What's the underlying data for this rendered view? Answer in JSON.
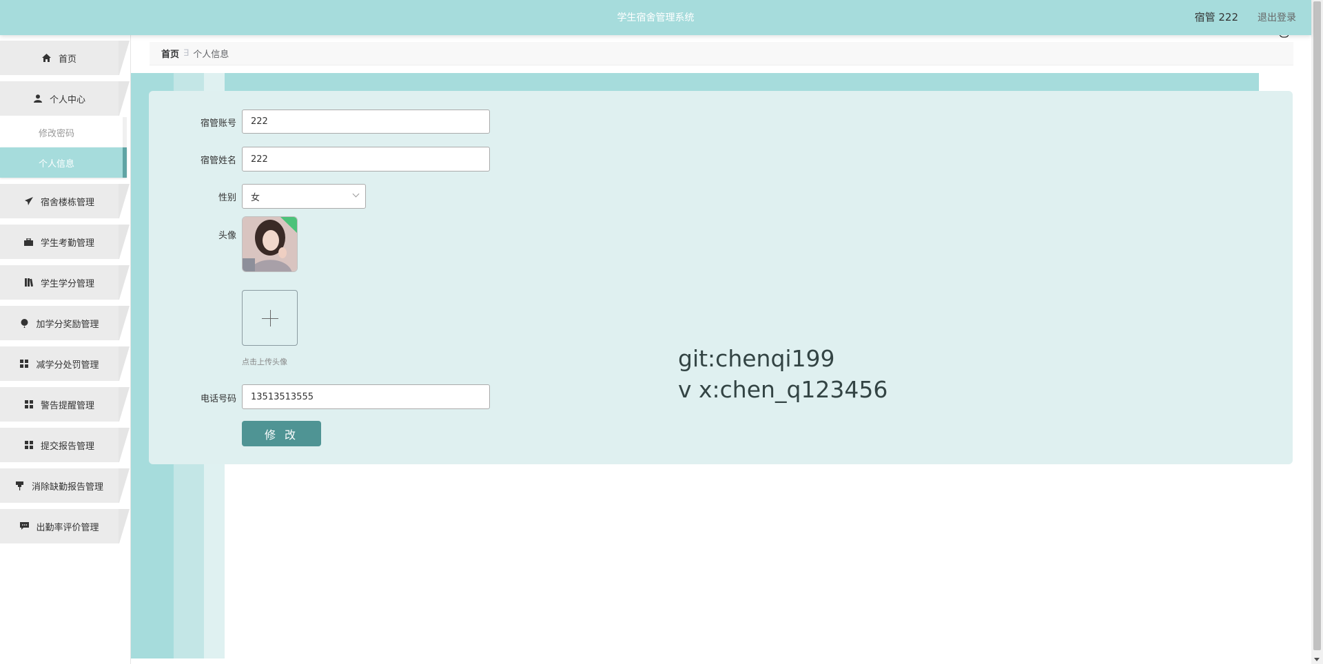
{
  "header": {
    "title": "学生宿舍管理系统",
    "user": "宿管 222",
    "logout": "退出登录"
  },
  "sidebar": {
    "items": [
      {
        "label": "首页",
        "icon": "home-icon"
      },
      {
        "label": "个人中心",
        "icon": "user-icon"
      },
      {
        "label": "宿舍楼栋管理",
        "icon": "paper-plane-icon"
      },
      {
        "label": "学生考勤管理",
        "icon": "briefcase-icon"
      },
      {
        "label": "学生学分管理",
        "icon": "book-icon"
      },
      {
        "label": "加学分奖励管理",
        "icon": "balloon-icon"
      },
      {
        "label": "减学分处罚管理",
        "icon": "grid-icon"
      },
      {
        "label": "警告提醒管理",
        "icon": "grid-icon"
      },
      {
        "label": "提交报告管理",
        "icon": "grid-icon"
      },
      {
        "label": "消除缺勤报告管理",
        "icon": "pushpin-icon"
      },
      {
        "label": "出勤率评价管理",
        "icon": "chat-icon"
      }
    ],
    "sub_items": [
      {
        "label": "修改密码",
        "active": false
      },
      {
        "label": "个人信息",
        "active": true
      }
    ]
  },
  "breadcrumb": {
    "home": "首页",
    "separator": "∃",
    "current": "个人信息"
  },
  "form": {
    "account_label": "宿管账号",
    "account_value": "222",
    "name_label": "宿管姓名",
    "name_value": "222",
    "gender_label": "性别",
    "gender_value": "女",
    "avatar_label": "头像",
    "upload_hint": "点击上传头像",
    "phone_label": "电话号码",
    "phone_value": "13513513555",
    "submit_label": "修 改"
  },
  "watermark": {
    "line1": "git:chenqi199",
    "line2": "v x:chen_q123456"
  },
  "colors": {
    "accent": "#a6dcdc",
    "card": "#dff0f0",
    "button": "#4f9494"
  }
}
